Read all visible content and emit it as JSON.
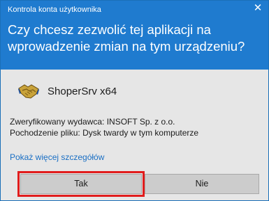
{
  "dialog": {
    "caption": "Kontrola konta użytkownika",
    "close_glyph": "✕",
    "question": "Czy chcesz zezwolić tej aplikacji na wprowadzenie zmian na tym urządzeniu?",
    "header_color": "#1f7bcf"
  },
  "app": {
    "icon": "handshake-icon",
    "name": "ShoperSrv x64"
  },
  "details": {
    "publisher": "Zweryfikowany wydawca: INSOFT Sp. z o.o.",
    "origin": "Pochodzenie pliku: Dysk twardy w tym komputerze"
  },
  "more_link": "Pokaż więcej szczegółów",
  "buttons": {
    "yes": "Tak",
    "no": "Nie",
    "highlight_color": "#e11d1d"
  }
}
